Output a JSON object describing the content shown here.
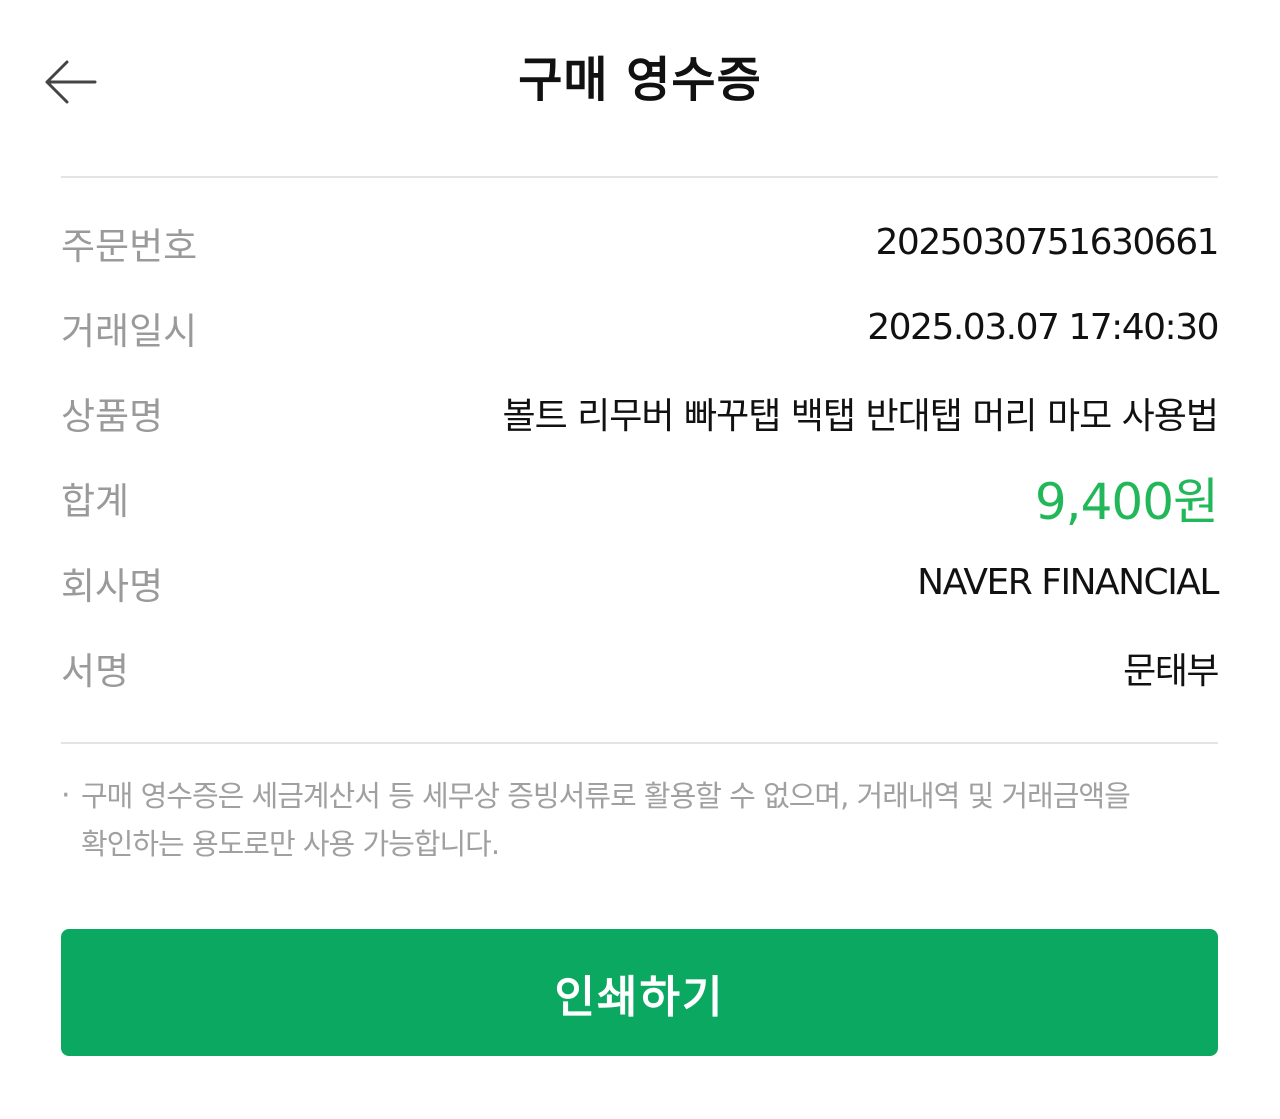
{
  "header": {
    "back_icon": "arrow-left-icon",
    "title": "구매 영수증"
  },
  "receipt": {
    "rows": [
      {
        "label": "주문번호",
        "value": "2025030751630661"
      },
      {
        "label": "거래일시",
        "value": "2025.03.07 17:40:30"
      },
      {
        "label": "상품명",
        "value": "볼트 리무버 빠꾸탭 백탭 반대탭 머리 마모 사용법"
      },
      {
        "label": "합계",
        "value": "9,400원"
      },
      {
        "label": "회사명",
        "value": "NAVER FINANCIAL"
      },
      {
        "label": "서명",
        "value": "문태부"
      }
    ]
  },
  "notice": {
    "bullet": "·",
    "text": "구매 영수증은 세금계산서 등 세무상 증빙서류로 활용할 수 없으며, 거래내역 및 거래금액을 확인하는 용도로만 사용 가능합니다."
  },
  "print_button": {
    "label": "인쇄하기"
  },
  "colors": {
    "accent": "#0aa860",
    "total": "#22b85a",
    "label": "#9a9a9a"
  }
}
